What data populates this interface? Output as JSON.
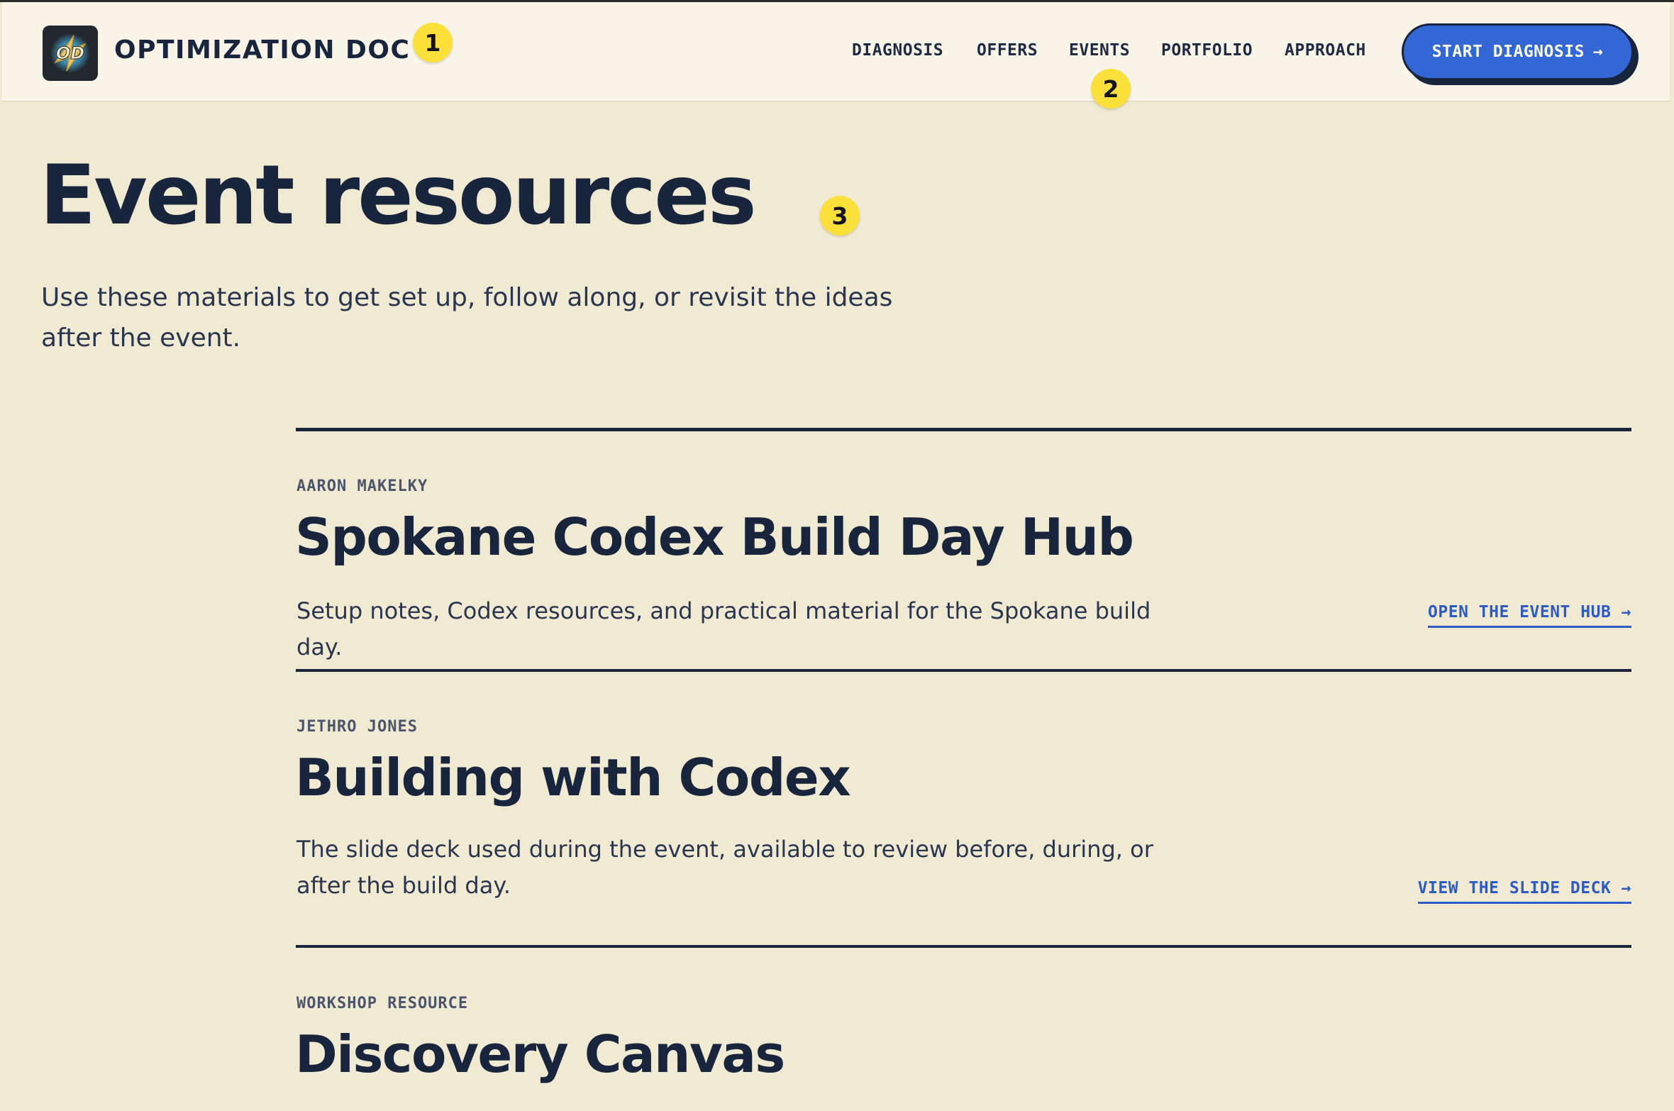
{
  "header": {
    "brand": "OPTIMIZATION DOC",
    "nav": [
      {
        "label": "DIAGNOSIS"
      },
      {
        "label": "OFFERS"
      },
      {
        "label": "EVENTS"
      },
      {
        "label": "PORTFOLIO"
      },
      {
        "label": "APPROACH"
      }
    ],
    "cta_label": "START DIAGNOSIS",
    "cta_arrow": "→"
  },
  "markers": [
    "1",
    "2",
    "3"
  ],
  "hero": {
    "title": "Event resources",
    "intro": "Use these materials to get set up, follow along, or revisit the ideas after the event."
  },
  "resources": [
    {
      "eyebrow": "AARON MAKELKY",
      "title": "Spokane Codex Build Day Hub",
      "description": "Setup notes, Codex resources, and practical material for the Spokane build day.",
      "link_label": "OPEN THE EVENT HUB →"
    },
    {
      "eyebrow": "JETHRO JONES",
      "title": "Building with Codex",
      "description": "The slide deck used during the event, available to review before, during, or after the build day.",
      "link_label": "VIEW THE SLIDE DECK →"
    },
    {
      "eyebrow": "WORKSHOP RESOURCE",
      "title": "Discovery Canvas"
    }
  ],
  "colors": {
    "background": "#f1ead3",
    "header_background": "#f8f4e7",
    "ink": "#19243d",
    "accent_blue": "#3367d6",
    "link_blue": "#2d5bc6",
    "marker_yellow": "#fbe03a"
  }
}
